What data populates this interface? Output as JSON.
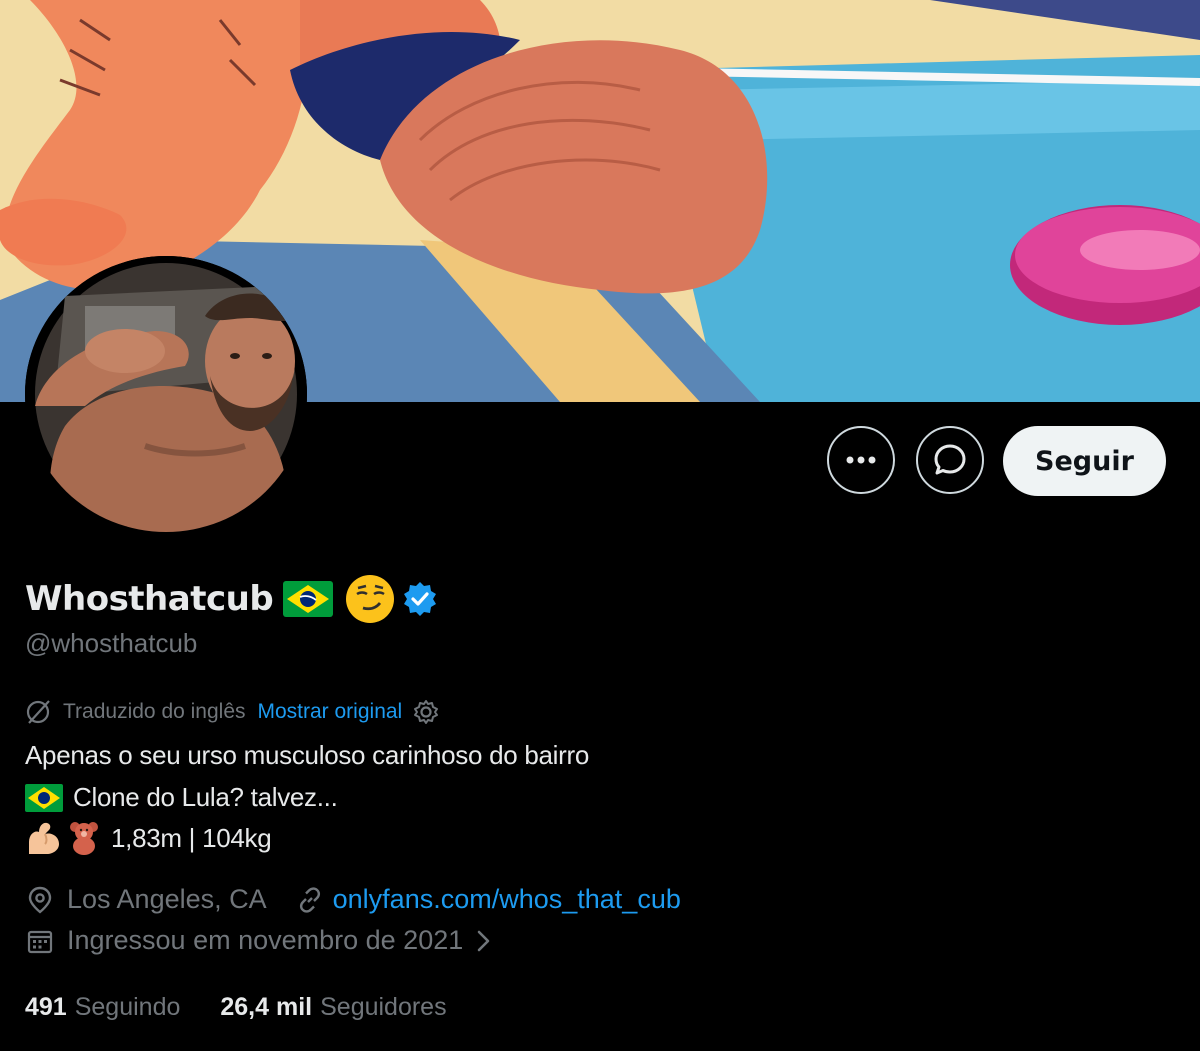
{
  "profile": {
    "display_name": "Whosthatcub",
    "handle": "@whosthatcub",
    "verified": true,
    "follow_label": "Seguir"
  },
  "translation": {
    "label": "Traduzido do inglês",
    "show_original": "Mostrar original"
  },
  "bio": {
    "line1": "Apenas o seu urso musculoso carinhoso do bairro",
    "line2": "Clone do Lula? talvez...",
    "line3": "1,83m | 104kg"
  },
  "meta": {
    "location": "Los Angeles, CA",
    "website": "onlyfans.com/whos_that_cub",
    "joined": "Ingressou em novembro de 2021"
  },
  "stats": {
    "following_count": "491",
    "following_label": "Seguindo",
    "followers_count": "26,4 mil",
    "followers_label": "Seguidores"
  },
  "icons": {
    "more": "more-icon",
    "message": "message-icon",
    "verified": "verified-badge-icon",
    "translate": "translate-icon",
    "settings": "gear-icon",
    "location": "location-pin-icon",
    "link": "link-icon",
    "calendar": "calendar-icon",
    "chevron": "chevron-right-icon"
  },
  "colors": {
    "accent": "#1d9bf0",
    "muted": "#71767b",
    "text": "#e7e9ea",
    "follow_bg": "#eff3f4"
  }
}
